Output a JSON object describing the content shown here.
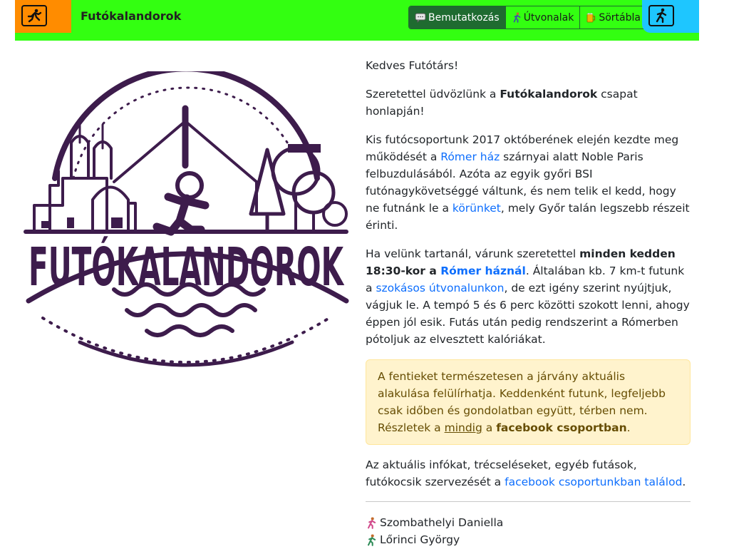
{
  "brand": "Futókalandorok",
  "nav": {
    "left_button_icon": "runner-icon",
    "right_button_icon": "runner-icon",
    "items": [
      {
        "icon": "speech-bubble-icon",
        "label": "Bemutatkozás",
        "active": true
      },
      {
        "icon": "runner-icon",
        "label": "Útvonalak",
        "active": false
      },
      {
        "icon": "beer-mug-icon",
        "label": "Sörtábla",
        "active": false
      }
    ]
  },
  "logo": {
    "text": "FUTÓKALANDOROK"
  },
  "content": {
    "greeting": "Kedves Futótárs!",
    "welcome": {
      "before": "Szeretettel üdvözlünk a ",
      "bold": "Futókalandorok",
      "after": " csapat honlapján!"
    },
    "history": {
      "t1": "Kis futócsoportunk 2017 októberének elején kezdte meg működését a ",
      "link1": "Rómer ház",
      "t2": " szárnyai alatt Noble Paris felbuzdulásából. Azóta az egyik győri BSI futónagykövetséggé váltunk, és nem telik el kedd, hogy ne futnánk le a ",
      "link2": "körünket",
      "t3": ", mely Győr talán legszebb részeit érinti."
    },
    "schedule": {
      "t1": "Ha velünk tartanál, várunk szeretettel ",
      "b1": "minden kedden 18:30-kor a ",
      "b_link": "Rómer háznál",
      "t2": ". Általában kb. 7 km-t futunk a ",
      "link": "szokásos útvonalunkon",
      "t3": ", de ezt igény szerint nyújtjuk, vágjuk le. A tempó 5 és 6 perc közötti szokott lenni, ahogy éppen jól esik. Futás után pedig rendszerint a Rómerben pótoljuk az elvesztett kalóriákat."
    },
    "alert": {
      "t1": "A fentieket természetesen a járvány aktuális alakulása felülírhatja. Keddenként futunk, legfeljebb csak időben és gondolatban együtt, térben nem. Részletek a ",
      "link": "mindig",
      "t2": " a ",
      "bold": "facebook csoportban",
      "t3": "."
    },
    "info": {
      "t1": "Az aktuális infókat, trécseléseket, egyéb futások, futókocsik szervezését a ",
      "link": "facebook csoportunkban találod",
      "t2": "."
    },
    "members": [
      "Szombathelyi Daniella",
      "Lőrinci György"
    ]
  },
  "colors": {
    "navbar": "#33ff11",
    "left_box": "#ff8c00",
    "right_box": "#1ec6ff",
    "active_button": "#1f6b30",
    "logo": "#3d1c4c",
    "link": "#0d6efd",
    "alert_bg": "#fff3cd",
    "alert_text": "#664d03"
  }
}
